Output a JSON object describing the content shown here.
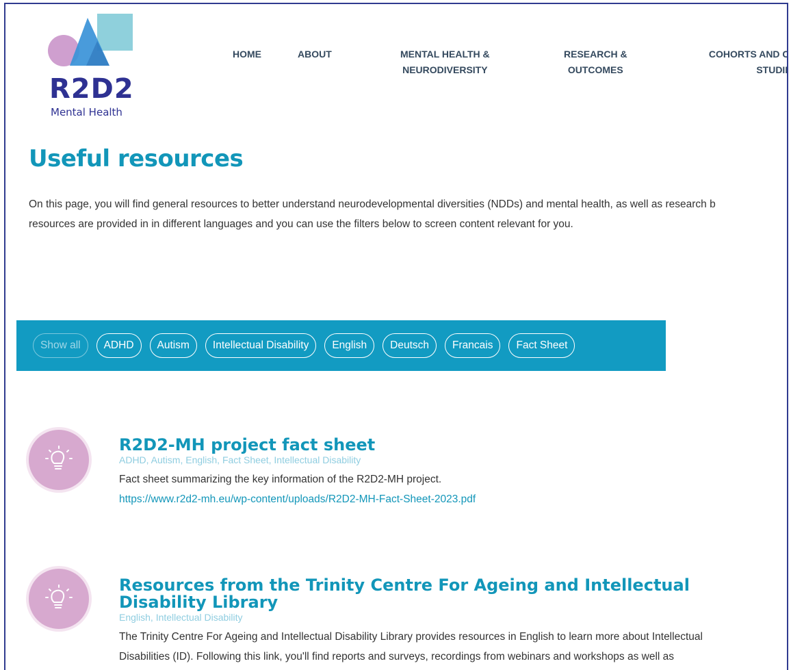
{
  "logo": {
    "brand": "R2D2",
    "subtitle": "Mental Health"
  },
  "nav": {
    "items": [
      {
        "label": "HOME"
      },
      {
        "label": "ABOUT"
      },
      {
        "label": "MENTAL HEALTH &\nNEURODIVERSITY"
      },
      {
        "label": "RESEARCH &\nOUTCOMES"
      },
      {
        "label": "COHORTS AND CLI\nSTUDIES"
      }
    ]
  },
  "page": {
    "title": "Useful resources",
    "intro_line1": "On this page, you will find general resources to better understand neurodevelopmental diversities (NDDs) and mental health, as well as research b",
    "intro_line2": "resources are provided in in different languages and you can use the filters below to screen content relevant for you."
  },
  "filters": [
    {
      "label": "Show all",
      "active": false
    },
    {
      "label": "ADHD"
    },
    {
      "label": "Autism"
    },
    {
      "label": "Intellectual Disability"
    },
    {
      "label": "English"
    },
    {
      "label": "Deutsch"
    },
    {
      "label": "Francais"
    },
    {
      "label": "Fact Sheet"
    }
  ],
  "resources": [
    {
      "icon": "lightbulb-icon",
      "title": "R2D2-MH project fact sheet",
      "tags": "ADHD, Autism, English, Fact Sheet, Intellectual Disability",
      "description": "Fact sheet summarizing the key information of the R2D2-MH project.",
      "link": "https://www.r2d2-mh.eu/wp-content/uploads/R2D2-MH-Fact-Sheet-2023.pdf"
    },
    {
      "icon": "lightbulb-icon",
      "title": "Resources from the Trinity Centre For Ageing and Intellectual Disability Library",
      "tags": "English, Intellectual Disability",
      "description": "The Trinity Centre For Ageing and Intellectual Disability Library provides resources in English to learn more about Intellectual Disabilities (ID). Following this link, you'll find reports and surveys, recordings from webinars and workshops as well as"
    }
  ],
  "colors": {
    "accent": "#1296b9",
    "filter_bar": "#129bc2",
    "icon_circle": "#d7a9cf",
    "brand": "#2e3192"
  }
}
